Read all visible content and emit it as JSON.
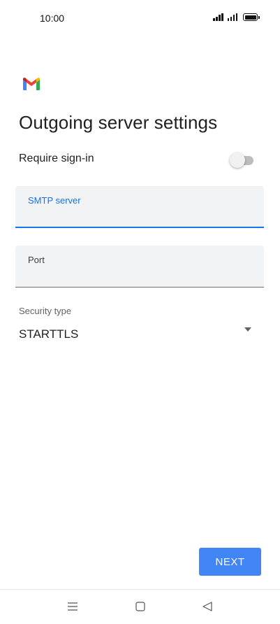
{
  "status_bar": {
    "time": "10:00",
    "icons": [
      "signal-icon",
      "signal-icon",
      "battery-icon"
    ]
  },
  "app": {
    "logo": "gmail-logo-icon",
    "colors": {
      "accent": "#1a73e8",
      "button": "#4285f4",
      "field_bg": "#f1f3f4"
    }
  },
  "page": {
    "title": "Outgoing server settings"
  },
  "require_signin": {
    "label": "Require sign-in",
    "enabled": false
  },
  "smtp_server": {
    "label": "SMTP server",
    "value": "",
    "focused": true
  },
  "port": {
    "label": "Port",
    "value": ""
  },
  "security_type": {
    "label": "Security type",
    "value": "STARTTLS",
    "icon": "dropdown-arrow-icon"
  },
  "actions": {
    "next_label": "NEXT"
  },
  "nav_bar": {
    "icons": [
      "menu-icon",
      "home-icon",
      "back-icon"
    ]
  }
}
